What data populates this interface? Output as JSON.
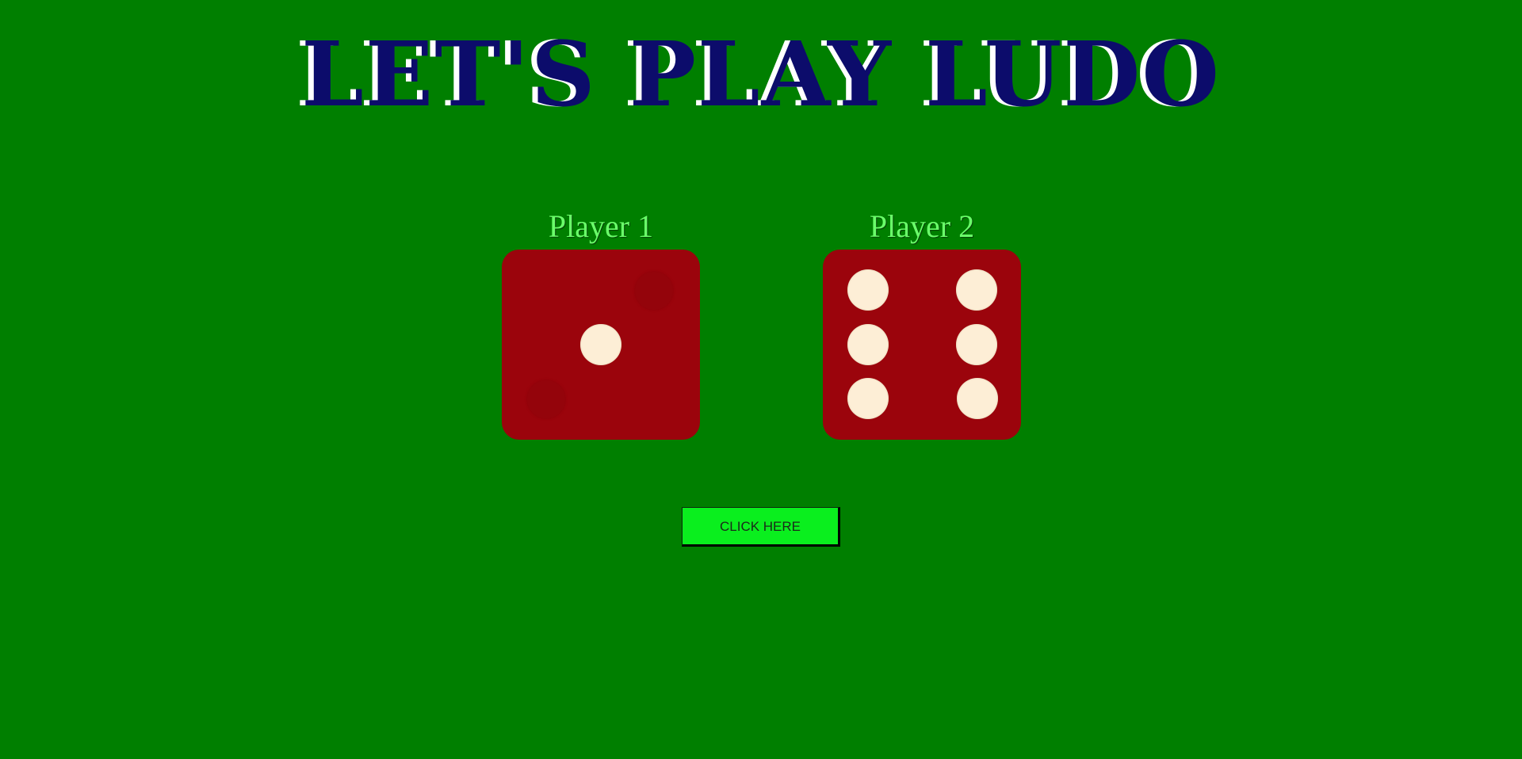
{
  "title": "LET'S PLAY LUDO",
  "players": [
    {
      "name": "Player 1",
      "die_value": 1
    },
    {
      "name": "Player 2",
      "die_value": 6
    }
  ],
  "button": {
    "label": "CLICK HERE"
  },
  "colors": {
    "background": "#007f00",
    "title": "#0c0c6b",
    "title_shadow": "#ffffff",
    "player_name": "#6aff6a",
    "die": "#9b040c",
    "pip": "#fdeed6",
    "button": "#0aef1e"
  }
}
